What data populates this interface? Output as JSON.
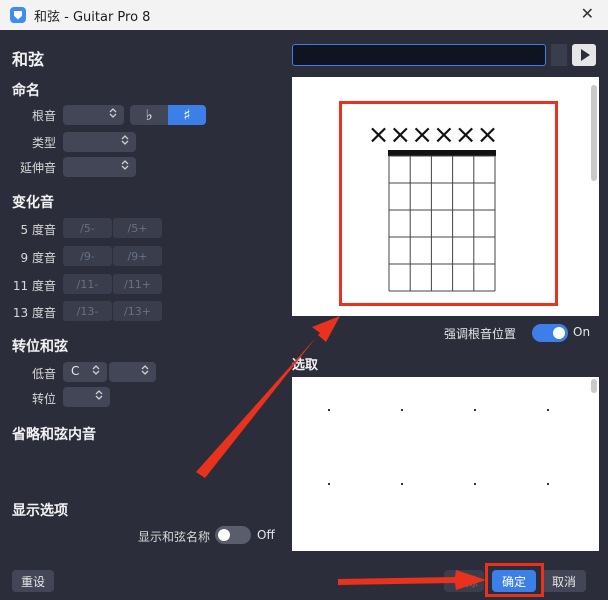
{
  "window": {
    "title": "和弦 - Guitar Pro 8"
  },
  "left": {
    "heading": "和弦",
    "naming": {
      "heading": "命名",
      "root_label": "根音",
      "flat_glyph": "♭",
      "sharp_glyph": "♯",
      "type_label": "类型",
      "extension_label": "延伸音"
    },
    "alterations": {
      "heading": "变化音",
      "rows": [
        {
          "label": "5 度音",
          "minus": "/5-",
          "plus": "/5+"
        },
        {
          "label": "9 度音",
          "minus": "/9-",
          "plus": "/9+"
        },
        {
          "label": "11 度音",
          "minus": "/11-",
          "plus": "/11+"
        },
        {
          "label": "13 度音",
          "minus": "/13-",
          "plus": "/13+"
        }
      ]
    },
    "inversion": {
      "heading": "转位和弦",
      "bass_label": "低音",
      "bass_value": "C",
      "inversion_label": "转位"
    },
    "omissions_heading": "省略和弦内音",
    "display": {
      "heading": "显示选项",
      "show_name_label": "显示和弦名称",
      "show_name_state": "Off"
    }
  },
  "right": {
    "diagram": {
      "muted_marks": "××××××",
      "strings": 6,
      "frets": 5
    },
    "highlight_root_label": "强调根音位置",
    "highlight_root_state": "On",
    "pick_label_visible": "选取"
  },
  "footer": {
    "reset_label": "重设",
    "delete_label_partial": "除",
    "ok_label": "确定",
    "cancel_label": "取消"
  },
  "colors": {
    "accent": "#3d7fe8",
    "annotation_red": "#e8321e",
    "background": "#2b2d3a"
  }
}
